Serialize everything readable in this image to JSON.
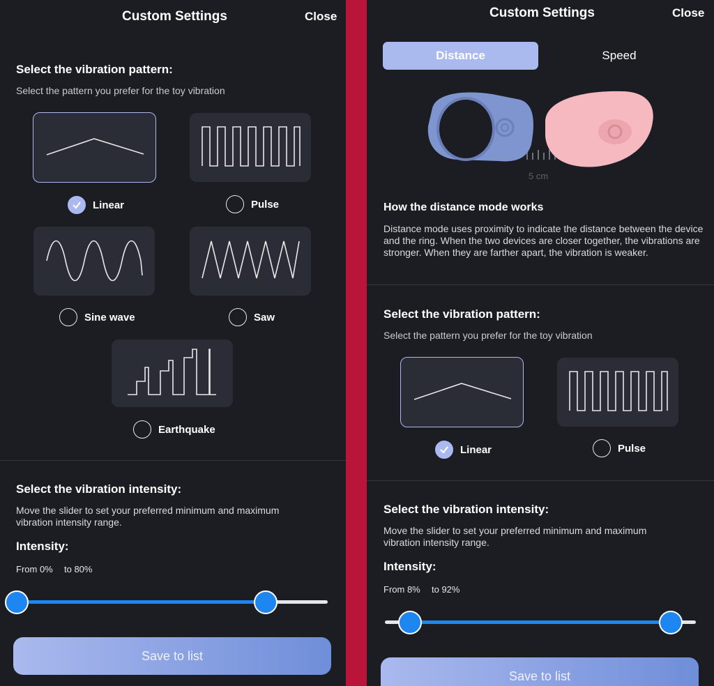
{
  "left": {
    "header": {
      "title": "Custom Settings",
      "close_label": "Close"
    },
    "pattern": {
      "heading": "Select the vibration pattern:",
      "subheading": "Select the pattern you prefer for the toy vibration",
      "options": [
        {
          "label": "Linear",
          "icon": "linear-wave-icon",
          "selected": true
        },
        {
          "label": "Pulse",
          "icon": "pulse-wave-icon",
          "selected": false
        },
        {
          "label": "Sine wave",
          "icon": "sine-wave-icon",
          "selected": false
        },
        {
          "label": "Saw",
          "icon": "saw-wave-icon",
          "selected": false
        },
        {
          "label": "Earthquake",
          "icon": "earthquake-wave-icon",
          "selected": false
        }
      ]
    },
    "intensity": {
      "heading": "Select the vibration intensity:",
      "description": "Move the slider to set your preferred minimum and maximum vibration intensity range.",
      "label": "Intensity:",
      "from_text": "From 0%",
      "to_text": "to 80%",
      "min_percent": 0,
      "max_percent": 80
    },
    "save_label": "Save to list"
  },
  "right": {
    "header": {
      "title": "Custom Settings",
      "close_label": "Close"
    },
    "tabs": [
      {
        "label": "Distance",
        "active": true
      },
      {
        "label": "Speed",
        "active": false
      }
    ],
    "illustration": {
      "distance_label": "5 cm",
      "ring_color": "#7f95cf",
      "device_color": "#f5b9bf"
    },
    "distance_info": {
      "heading": "How the distance mode works",
      "text": "Distance mode uses proximity to indicate the distance between the device and the ring. When the two devices are closer together, the vibrations are stronger. When they are farther apart, the vibration is weaker."
    },
    "pattern": {
      "heading": "Select the vibration pattern:",
      "subheading": "Select the pattern you prefer for the toy vibration",
      "options": [
        {
          "label": "Linear",
          "icon": "linear-wave-icon",
          "selected": true
        },
        {
          "label": "Pulse",
          "icon": "pulse-wave-icon",
          "selected": false
        }
      ]
    },
    "intensity": {
      "heading": "Select the vibration intensity:",
      "description": "Move the slider to set your preferred minimum and maximum vibration intensity range.",
      "label": "Intensity:",
      "from_text": "From 8%",
      "to_text": "to 92%",
      "min_percent": 8,
      "max_percent": 92
    },
    "save_label": "Save to list"
  },
  "colors": {
    "background": "#1b1d22",
    "card": "#2a2d35",
    "accent": "#aab9ee",
    "slider": "#1d86f0",
    "frame": "#b9153b"
  }
}
